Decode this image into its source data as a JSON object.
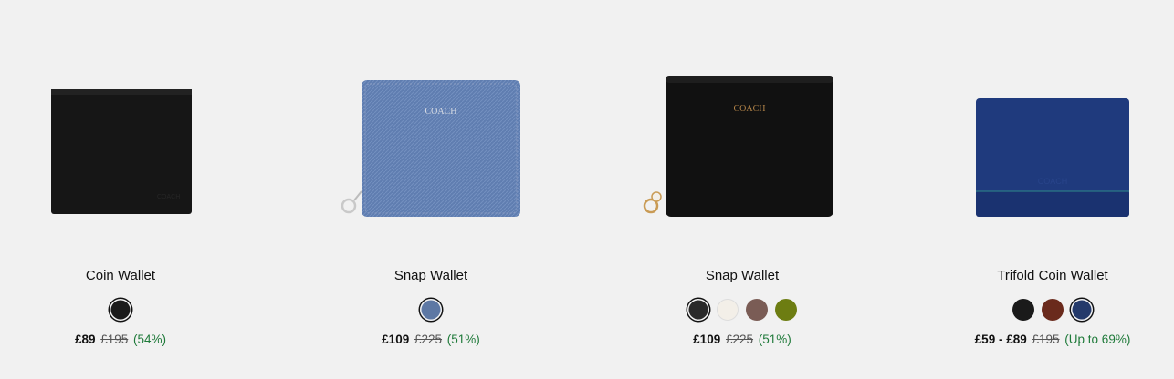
{
  "products": [
    {
      "name": "Coin Wallet",
      "swatches": [
        {
          "color": "#1b1b1b",
          "selected": true
        }
      ],
      "price": {
        "current": "£89",
        "original": "£195",
        "discount": "(54%)"
      }
    },
    {
      "name": "Snap Wallet",
      "swatches": [
        {
          "color": "#5d78a4",
          "selected": true
        }
      ],
      "price": {
        "current": "£109",
        "original": "£225",
        "discount": "(51%)"
      }
    },
    {
      "name": "Snap Wallet",
      "swatches": [
        {
          "color": "#2a2a2a",
          "selected": true
        },
        {
          "color": "#f3efe8",
          "selected": false
        },
        {
          "color": "#7a5c55",
          "selected": false
        },
        {
          "color": "#6d7d12",
          "selected": false
        }
      ],
      "price": {
        "current": "£109",
        "original": "£225",
        "discount": "(51%)"
      }
    },
    {
      "name": "Trifold Coin Wallet",
      "swatches": [
        {
          "color": "#1a1a1a",
          "selected": false
        },
        {
          "color": "#6a2a1c",
          "selected": false
        },
        {
          "color": "#243a6b",
          "selected": true
        }
      ],
      "price": {
        "current": "£59 - £89",
        "original": "£195",
        "discount": "(Up to 69%)"
      }
    }
  ]
}
